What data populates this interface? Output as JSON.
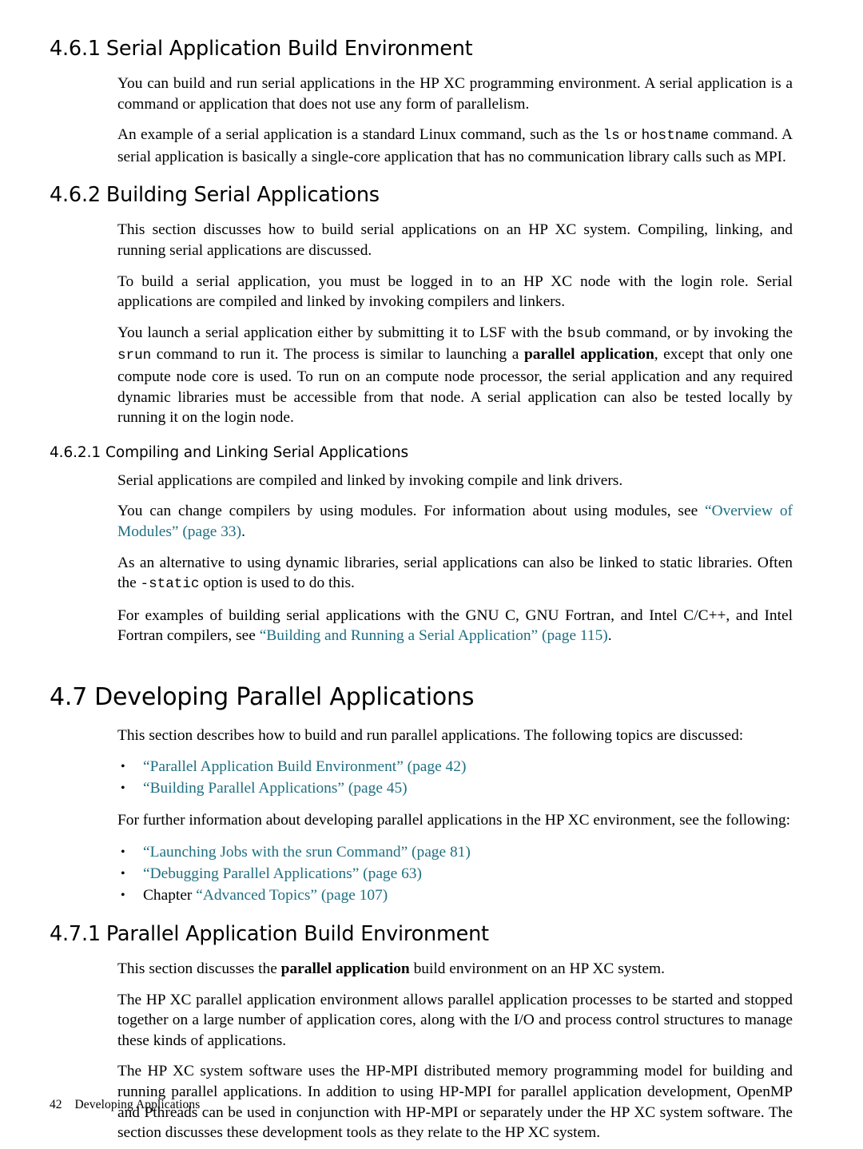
{
  "document": {
    "footer": {
      "page_number": "42",
      "title": "Developing Applications"
    }
  },
  "sections": [
    {
      "id": "4.6.1",
      "number": "4.6.1",
      "heading": "Serial Application Build Environment",
      "paragraphs": [
        "You can build and run serial applications in the HP XC programming environment. A serial application is a command or application that does not use any form of parallelism.",
        "An example of a serial application is a standard Linux command, such as the ls or hostname command. A serial application is basically a single-core application that has no communication library calls such as MPI."
      ]
    },
    {
      "id": "4.6.2",
      "number": "4.6.2",
      "heading": "Building Serial Applications",
      "paragraphs": [
        "This section discusses how to build serial applications on an HP XC system. Compiling, linking, and running serial applications are discussed.",
        "To build a serial application, you must be logged in to an HP XC node with the login role. Serial applications are compiled and linked by invoking compilers and linkers.",
        "You launch a serial application either by submitting it to LSF with the bsub command, or by invoking the srun command to run it. The process is similar to launching a parallel application, except that only one compute node core is used. To run on an compute node processor, the serial application and any required dynamic libraries must be accessible from that node. A serial application can also be tested locally by running it on the login node."
      ]
    },
    {
      "id": "4.6.2.1",
      "number": "4.6.2.1",
      "heading": "Compiling and Linking Serial Applications",
      "paragraphs": [
        "Serial applications are compiled and linked by invoking compile and link drivers.",
        "You can change compilers by using modules. For information about using modules, see “Overview of Modules” (page 33).",
        "As an alternative to using dynamic libraries, serial applications can also be linked to static libraries. Often the -static option is used to do this.",
        "For examples of building serial applications with the GNU C, GNU Fortran, and Intel C/C++, and Intel Fortran compilers, see “Building and Running a Serial Application” (page 115)."
      ]
    },
    {
      "id": "4.7",
      "number": "4.7",
      "heading": "Developing Parallel Applications",
      "paragraphs": [
        "This section describes how to build and run parallel applications. The following topics are discussed:",
        "For further information about developing parallel applications in the HP XC environment, see the following:"
      ],
      "bullets_1": [
        "“Parallel Application Build Environment” (page 42)",
        "“Building Parallel Applications” (page 45)"
      ],
      "bullets_2": [
        "“Launching Jobs with the srun Command” (page 81)",
        "“Debugging Parallel Applications” (page 63)",
        "Chapter “Advanced Topics” (page 107)"
      ]
    },
    {
      "id": "4.7.1",
      "number": "4.7.1",
      "heading": "Parallel Application Build Environment",
      "paragraphs": [
        "This section discusses the parallel application build environment on an HP XC system.",
        "The HP XC parallel application environment allows parallel application processes to be started and stopped together on a large number of application cores, along with the I/O and process control structures to manage these kinds of applications.",
        "The HP XC system software uses the HP-MPI distributed memory programming model for building and running parallel applications. In addition to using HP-MPI for parallel application development, OpenMP and Pthreads can be used in conjunction with HP-MPI or separately under the HP XC system software. The section discusses these development tools as they relate to the HP XC system."
      ]
    }
  ],
  "inline": {
    "ls": "ls",
    "hostname": "hostname",
    "bsub": "bsub",
    "srun": "srun",
    "static_option": "-static",
    "parallel_application": "parallel application",
    "xref_modules": "“Overview of Modules” (page 33)",
    "xref_serial_app": "“Building and Running a Serial Application” (page 115)"
  }
}
